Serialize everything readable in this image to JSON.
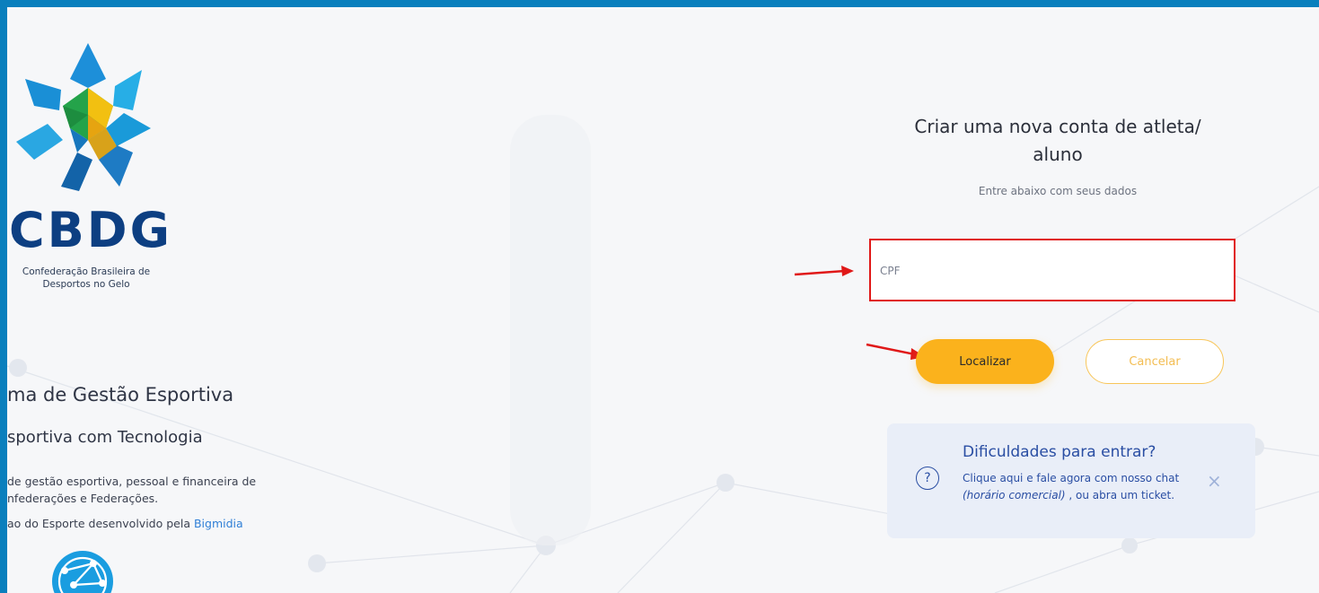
{
  "brand": {
    "logo_icon": "cbdg-star-logo",
    "name": "CBDG",
    "subtitle_line1": "Confederação Brasileira de",
    "subtitle_line2": "Desportos no Gelo"
  },
  "left": {
    "title": "ma de Gestão Esportiva",
    "subtitle": "sportiva com Tecnologia",
    "desc_line1": "de gestão esportiva, pessoal e financeira de",
    "desc_line2": "nfederações e Federações.",
    "credit_text": "ao do Esporte desenvolvido pela ",
    "credit_link": "Bigmidia"
  },
  "form": {
    "title_line1": "Criar uma nova conta de atleta/",
    "title_line2": "aluno",
    "subtitle": "Entre abaixo com seus dados",
    "cpf_placeholder": "CPF",
    "cpf_value": "",
    "locate_label": "Localizar",
    "cancel_label": "Cancelar"
  },
  "help": {
    "icon": "question-circle-icon",
    "title": "Dificuldades para entrar?",
    "text_start": "Clique aqui e fale agora com nosso chat ",
    "text_italic": "(horário comercial)",
    "text_end": " , ou abra um ticket.",
    "close_glyph": "×"
  },
  "colors": {
    "frame_border": "#0a7fbd",
    "accent": "#fbb21c",
    "highlight": "#e01818",
    "help_text": "#2a4ea3"
  }
}
